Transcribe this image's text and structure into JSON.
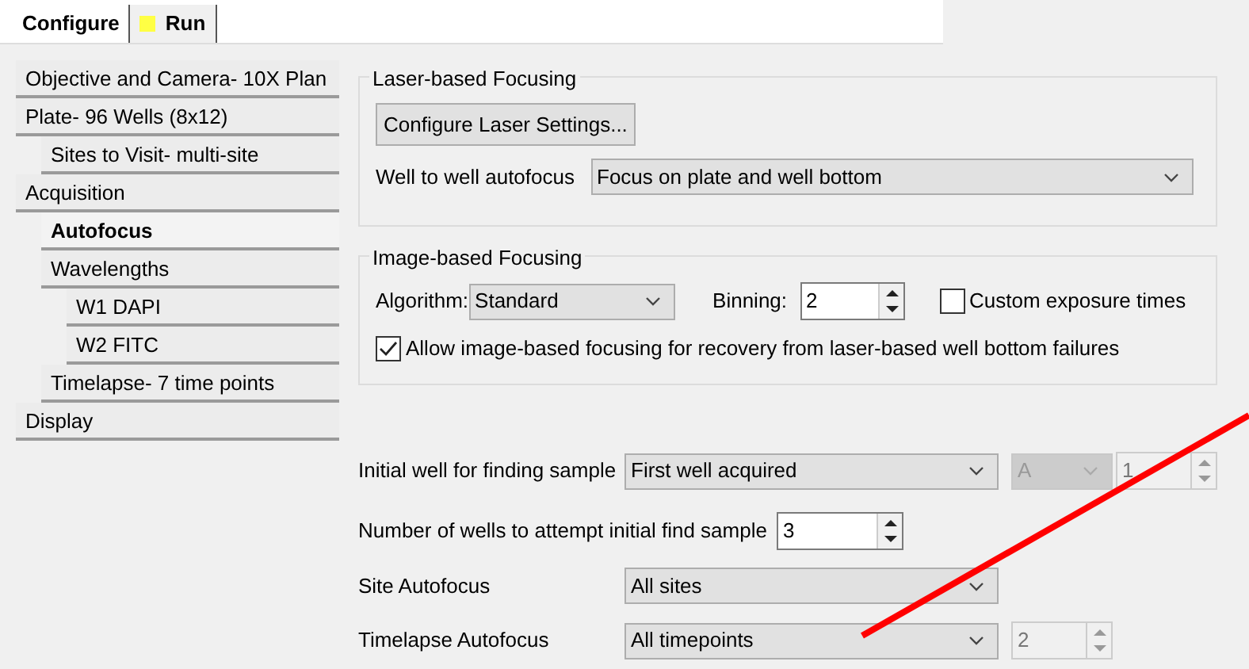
{
  "tabs": [
    {
      "label": "Configure",
      "selected": true,
      "indicator": false
    },
    {
      "label": "Run",
      "selected": false,
      "indicator": true
    }
  ],
  "sidebar": {
    "items": [
      {
        "label": "Objective and Camera- 10X Plan",
        "selected": false
      },
      {
        "label": "Plate- 96 Wells (8x12)",
        "selected": false,
        "children": [
          {
            "label": "Sites to Visit- multi-site",
            "selected": false
          }
        ]
      },
      {
        "label": "Acquisition",
        "selected": false,
        "children": [
          {
            "label": "Autofocus",
            "selected": true
          },
          {
            "label": "Wavelengths",
            "selected": false,
            "children": [
              {
                "label": "W1 DAPI",
                "selected": false
              },
              {
                "label": "W2 FITC",
                "selected": false
              }
            ]
          },
          {
            "label": "Timelapse- 7 time points",
            "selected": false
          }
        ]
      },
      {
        "label": "Display",
        "selected": false
      }
    ]
  },
  "laser_group": {
    "title": "Laser-based Focusing",
    "button": "Configure Laser Settings...",
    "well_to_well": {
      "label": "Well to well autofocus",
      "value": "Focus on plate and well bottom"
    }
  },
  "image_group": {
    "title": "Image-based Focusing",
    "algorithm": {
      "label": "Algorithm:",
      "value": "Standard"
    },
    "binning": {
      "label": "Binning:",
      "value": "2"
    },
    "custom_exposure": {
      "label": "Custom exposure times",
      "checked": false
    },
    "allow_recovery": {
      "label": "Allow image-based focusing for recovery from laser-based well bottom failures",
      "checked": true
    }
  },
  "initial_well": {
    "label": "Initial well for finding sample",
    "value": "First well acquired",
    "row": {
      "value": "A",
      "disabled": true
    },
    "column": {
      "value": "1",
      "disabled": true
    }
  },
  "wells_to_attempt": {
    "label": "Number of wells to attempt initial find sample",
    "value": "3"
  },
  "site_autofocus": {
    "label": "Site Autofocus",
    "value": "All sites"
  },
  "timelapse_autofocus": {
    "label": "Timelapse Autofocus",
    "value": "All timepoints",
    "interval": {
      "value": "2",
      "disabled": true
    }
  }
}
